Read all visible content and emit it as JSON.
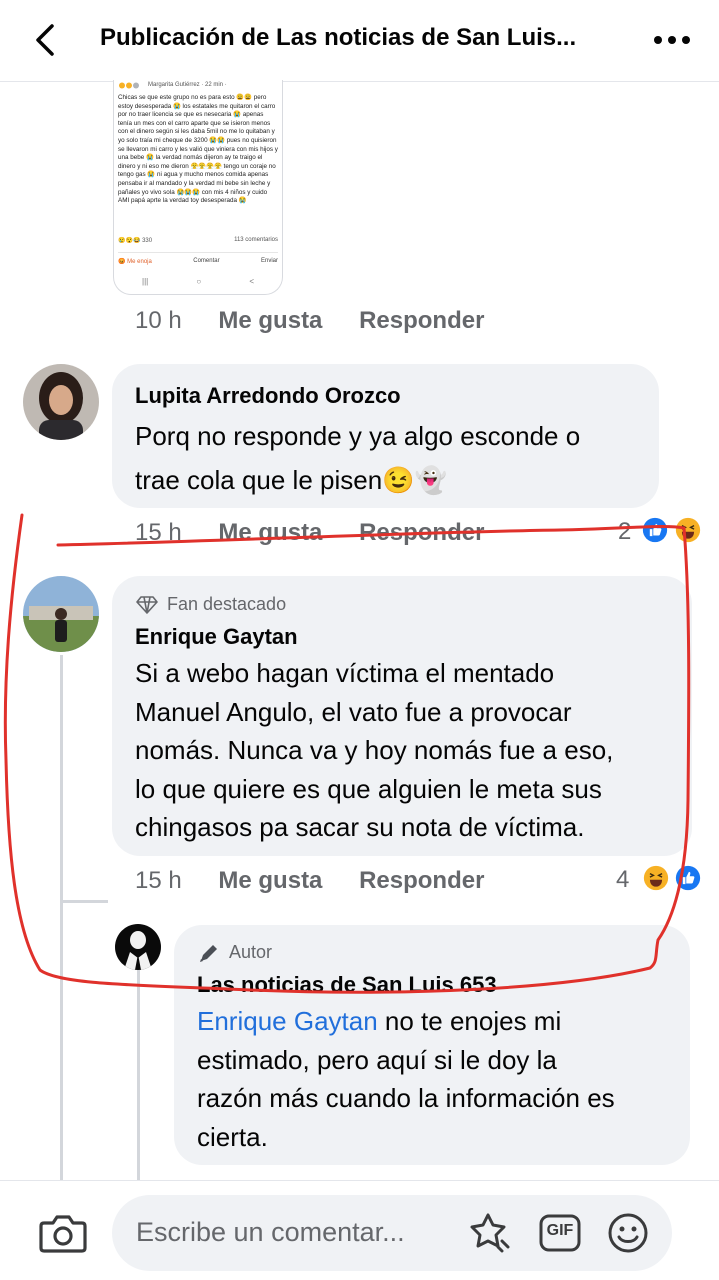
{
  "header": {
    "title": "Publicación de Las noticias de San Luis...",
    "back_icon": "chevron-left-icon",
    "more_icon": "more-horizontal-icon"
  },
  "embedded_screenshot": {
    "author": "Margarita Gutiérrez · 22 min · ",
    "text": "Chicas se que este grupo no es para esto 😩😩 pero estoy desesperada 😭 los estatales me quitaron el carro por no traer licencia se que es nesecaria 😭 apenas tenía un mes con el carro aparte que se isieron menos con el dinero según si les daba 5mil no me lo quitaban y yo solo traía mi cheque de 3200 😭😭 pues no quisieron se llevaron mi carro y les valió que viniera con mis hijos y una bebe 😭 la verdad nomás dijeron ay te traigo el dinero y ni eso me dieron 😤😤😤😤 tengo un coraje no tengo gas 😭 ni agua y mucho menos comida apenas pensaba ir al mandado y la verdad mi bebe sin leche y pañales yo vivo sola 😭😭😭 con mis 4 niños y cuido AMI papá aprte la verdad toy desesperada 😭",
    "reactions": "😢😯😂 330",
    "comments": "113 comentarios",
    "actions": [
      "😡 Me enoja",
      "Comentar",
      "Enviar"
    ],
    "nav": [
      "|||",
      "○",
      "<"
    ]
  },
  "post_meta": {
    "time": "10 h",
    "like": "Me gusta",
    "reply": "Responder"
  },
  "comments": [
    {
      "author": "Lupita Arredondo Orozco",
      "text_line1": "Porq no responde y ya algo esconde o",
      "text_line2": "trae cola que le pisen😉👻",
      "time": "15 h",
      "like": "Me gusta",
      "reply": "Responder",
      "reaction_count": "2",
      "reaction_icons": [
        "like-reaction-icon",
        "haha-reaction-icon"
      ]
    },
    {
      "badge": "Fan destacado",
      "badge_icon": "diamond-icon",
      "author": "Enrique Gaytan",
      "lines": [
        "Si a webo hagan víctima el mentado",
        "Manuel Angulo, el vato fue a provocar",
        "nomás. Nunca va y hoy nomás fue a eso,",
        "lo que quiere es que alguien le meta sus",
        "chingasos pa sacar su nota de víctima."
      ],
      "time": "15 h",
      "like": "Me gusta",
      "reply": "Responder",
      "reaction_count": "4",
      "reaction_icons": [
        "haha-reaction-icon",
        "like-reaction-icon"
      ]
    },
    {
      "badge": "Autor",
      "badge_icon": "pencil-icon",
      "author": "Las noticias de San Luis 653",
      "mention": "Enrique Gaytan",
      "line1_rest": " no te enojes mi",
      "lines": [
        "estimado, pero aquí si le doy la",
        "razón más cuando la información es",
        "cierta."
      ]
    }
  ],
  "composer": {
    "placeholder": "Escribe un comentar...",
    "camera_icon": "camera-icon",
    "sticker_icon": "sticker-icon",
    "gif_label": "GIF",
    "emoji_icon": "emoji-icon"
  },
  "colors": {
    "accent_blue": "#216fdb",
    "bubble_gray": "#f0f2f5",
    "annotation_red": "#e0312b",
    "like_blue": "#1877f2",
    "haha_yellow": "#f7b125"
  }
}
